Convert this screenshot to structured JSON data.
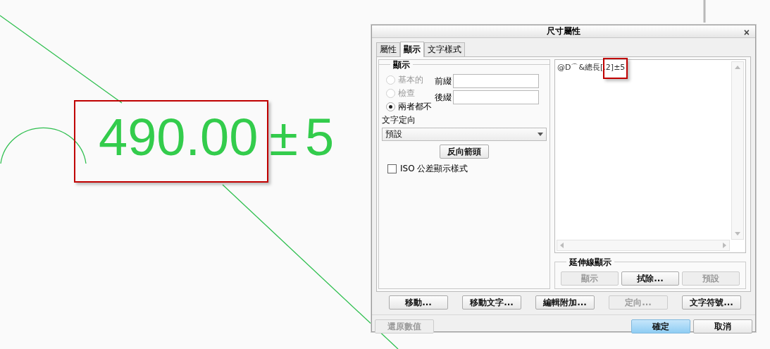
{
  "canvas": {
    "dimension": {
      "value": "490.00",
      "symbol": "±",
      "tolerance": "5",
      "highlighted": true
    }
  },
  "dialog": {
    "title": "尺寸屬性",
    "close": "×",
    "tabs": [
      {
        "label": "屬性",
        "selected": false
      },
      {
        "label": "顯示",
        "selected": true
      },
      {
        "label": "文字樣式",
        "selected": false
      }
    ],
    "display_group": {
      "title": "顯示",
      "radios": [
        {
          "label": "基本的",
          "selected": false,
          "disabled": true
        },
        {
          "label": "檢查",
          "selected": false,
          "disabled": true
        },
        {
          "label": "兩者都不",
          "selected": true,
          "disabled": false
        }
      ],
      "fields": [
        {
          "label": "前綴"
        },
        {
          "label": "後綴"
        }
      ],
      "orientation_label": "文字定向",
      "orientation_value": "預設",
      "flip_button": {
        "label": "反向箭頭",
        "disabled": false
      },
      "iso_checkbox": {
        "label": "ISO 公差顯示樣式",
        "checked": false
      }
    },
    "editor": {
      "value": "@D⌒&總長[.2]±5",
      "highlighted": true
    },
    "extension_group": {
      "title": "延伸線顯示",
      "buttons": [
        {
          "label": "顯示",
          "disabled": true
        },
        {
          "label": "拭除...",
          "disabled": false
        },
        {
          "label": "預設",
          "disabled": true
        }
      ]
    },
    "action_buttons": [
      {
        "label": "移動...",
        "disabled": false
      },
      {
        "label": "移動文字...",
        "disabled": false
      },
      {
        "label": "編輯附加...",
        "disabled": false
      },
      {
        "label": "定向...",
        "disabled": true
      },
      {
        "label": "文字符號...",
        "disabled": false
      }
    ],
    "restore_button": {
      "label": "還原數值",
      "disabled": true
    },
    "ok_button": {
      "label": "確定",
      "default": true
    },
    "cancel_button": {
      "label": "取消",
      "default": false
    }
  }
}
